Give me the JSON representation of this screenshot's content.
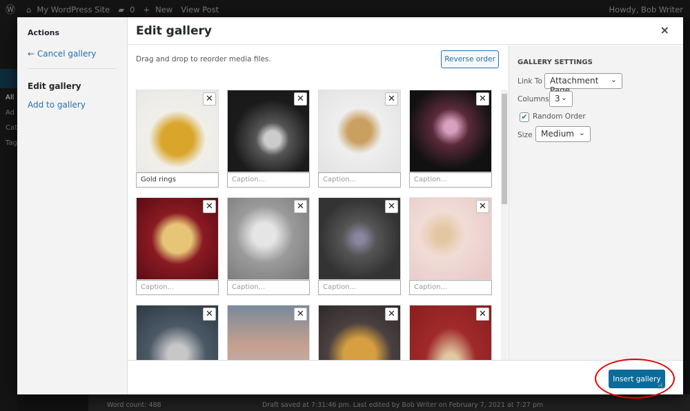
{
  "admin_bar": {
    "site": "My WordPress Site",
    "comments": "0",
    "new": "New",
    "view_post": "View Post",
    "howdy": "Howdy, Bob Writer"
  },
  "admin_menu": {
    "items": [
      "All",
      "Ad",
      "Cat",
      "Tag"
    ]
  },
  "status_bar": {
    "word_count": "Word count: 488",
    "draft": "Draft saved at 7:31:46 pm. Last edited by Bob Writer on February 7, 2021 at 7:27 pm"
  },
  "menu": {
    "heading": "Actions",
    "cancel": "← Cancel gallery",
    "current": "Edit gallery",
    "add": "Add to gallery"
  },
  "title": "Edit gallery",
  "close": "×",
  "content": {
    "hint": "Drag and drop to reorder media files.",
    "reverse": "Reverse order"
  },
  "tiles": [
    {
      "caption": "Gold rings",
      "placeholder": "Caption...",
      "bg": "radial-gradient(circle at 50% 60%,#d9a52b 0 25%,#f1efe9 45%,#e8e8e8)"
    },
    {
      "caption": "",
      "placeholder": "Caption...",
      "bg": "radial-gradient(circle at 55% 60%,#ccc 0 12%,#555 25%,#1a1a1a 60%)"
    },
    {
      "caption": "",
      "placeholder": "Caption...",
      "bg": "radial-gradient(ellipse at 50% 50%,#c9a060 0 20%,#eee 40%,#e3e3e3)"
    },
    {
      "caption": "",
      "placeholder": "Caption...",
      "bg": "radial-gradient(circle at 50% 45%,#d8a0c0 0 10%,#5a2a3a 30%,#111 70%)"
    },
    {
      "caption": "",
      "placeholder": "Caption...",
      "bg": "radial-gradient(circle at 50% 50%,#e6c577 0 25%,#8a1a22 45%,#5a0c14)"
    },
    {
      "caption": "",
      "placeholder": "Caption...",
      "bg": "radial-gradient(circle at 45% 45%,#e5e5e5 0 18%,#9a9a9a 45%,#777)"
    },
    {
      "caption": "",
      "placeholder": "Caption...",
      "bg": "radial-gradient(circle at 50% 50%,#8a86a0 0 8%,#555 30%,#333 70%)"
    },
    {
      "caption": "",
      "placeholder": "Caption...",
      "bg": "radial-gradient(circle at 40% 45%,#e3c7a0 0 10%,#f1dcd6 35%,#e8c6c6)"
    },
    {
      "caption": "",
      "placeholder": "Caption...",
      "bg": "radial-gradient(circle at 50% 60%,#c7c7c7 0 15%,#4b5966 45%,#2d3a44)"
    },
    {
      "caption": "",
      "placeholder": "Caption...",
      "bg": "linear-gradient(#7a8a9c,#c7a08f 50%,#c0bcc0)"
    },
    {
      "caption": "",
      "placeholder": "Caption...",
      "bg": "radial-gradient(circle at 50% 60%,#d6a040 0 25%,#4a4040 50%,#2e2a2a)"
    },
    {
      "caption": "",
      "placeholder": "Caption...",
      "bg": "radial-gradient(ellipse at 50% 75%,#e2c8a0 0 15%,#a02a2a 45%,#8a1e1e)"
    }
  ],
  "settings": {
    "heading": "GALLERY SETTINGS",
    "link_to_label": "Link To",
    "link_to": "Attachment Page",
    "columns_label": "Columns",
    "columns": "3",
    "random_label": "Random Order",
    "random_checked": true,
    "size_label": "Size",
    "size": "Medium"
  },
  "footer": {
    "insert": "Insert gallery"
  },
  "colors": {
    "accent": "#0a6c9b",
    "link": "#2271b1",
    "highlight_ring": "#e10000"
  }
}
